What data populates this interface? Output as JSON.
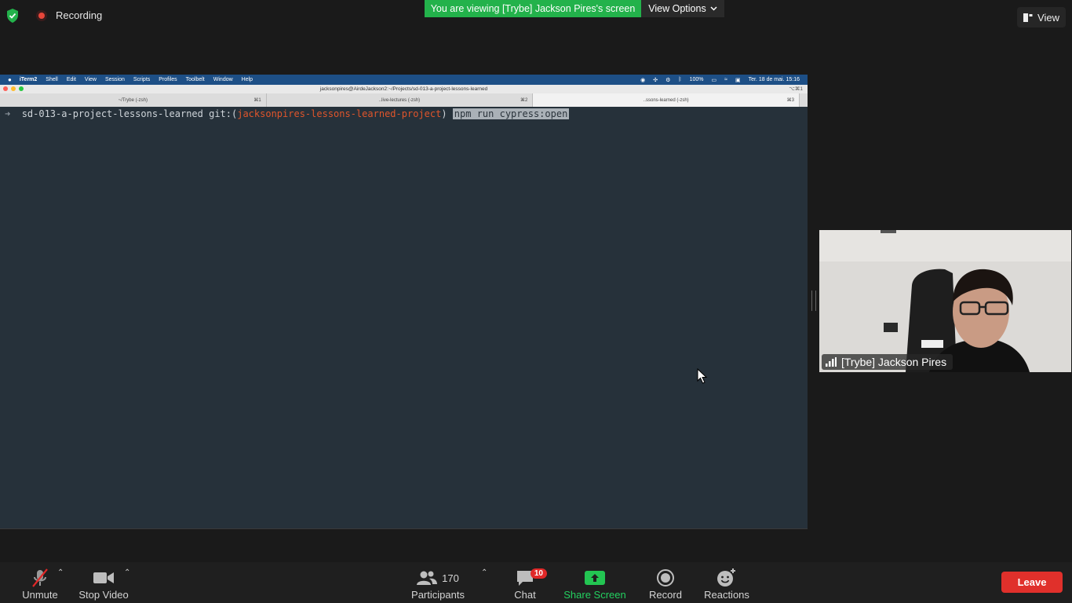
{
  "topbar": {
    "recording_label": "Recording",
    "viewing_banner": "You are viewing [Trybe] Jackson Pires's screen",
    "view_options_label": "View Options",
    "view_label": "View"
  },
  "shared_screen": {
    "menubar": {
      "items": [
        "iTerm2",
        "Shell",
        "Edit",
        "View",
        "Session",
        "Scripts",
        "Profiles",
        "Toolbelt",
        "Window",
        "Help"
      ],
      "battery": "100%",
      "datetime": "Ter. 18 de mai.  15:16"
    },
    "window_title": "jacksonpires@AirdeJackson2:~/Projects/sd-013-a-project-lessons-learned",
    "window_shortcut": "⌥⌘1",
    "tabs": [
      {
        "label": "~/Trybe (-zsh)",
        "shortcut": "⌘1"
      },
      {
        "label": "..live-lectures (-zsh)",
        "shortcut": "⌘2"
      },
      {
        "label": "..ssons-learned (-zsh)",
        "shortcut": "⌘3"
      }
    ],
    "terminal": {
      "prompt_arrow": "➜",
      "directory": "sd-013-a-project-lessons-learned",
      "git_prefix": "git:(",
      "branch": "jacksonpires-lessons-learned-project",
      "git_suffix": ")",
      "command": "npm run cypress:open"
    }
  },
  "participant_tile": {
    "name": "[Trybe] Jackson Pires"
  },
  "toolbar": {
    "unmute_label": "Unmute",
    "stop_video_label": "Stop Video",
    "participants_count": "170",
    "participants_label": "Participants",
    "chat_label": "Chat",
    "chat_badge": "10",
    "share_screen_label": "Share Screen",
    "record_label": "Record",
    "reactions_label": "Reactions",
    "leave_label": "Leave"
  }
}
